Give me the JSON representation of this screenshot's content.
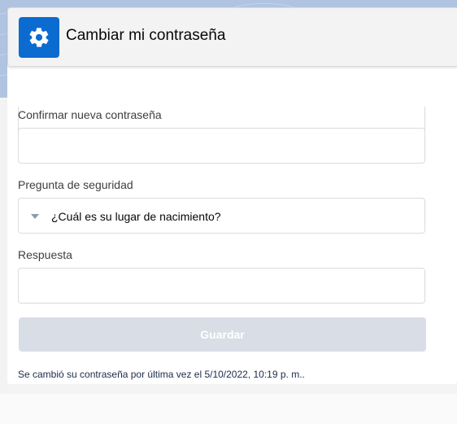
{
  "header": {
    "title": "Cambiar mi contraseña",
    "icon": "gear-icon",
    "icon_bg": "#0b6bd0"
  },
  "form": {
    "confirm_label": "Confirmar nueva contraseña",
    "confirm_value": "",
    "question_label": "Pregunta de seguridad",
    "question_value": "¿Cuál es su lugar de nacimiento?",
    "answer_label": "Respuesta",
    "answer_value": "",
    "save_label": "Guardar"
  },
  "status": {
    "last_changed": "Se cambió su contraseña por última vez el 5/10/2022, 10:19 p. m.."
  },
  "colors": {
    "accent": "#0b6bd0",
    "banner": "#b0c4df",
    "button_disabled": "#d8dde6"
  }
}
